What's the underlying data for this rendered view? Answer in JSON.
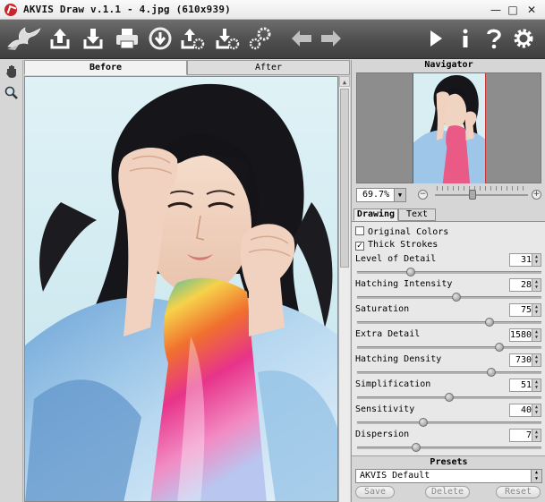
{
  "window": {
    "title": "AKVIS Draw v.1.1 - 4.jpg (610x939)",
    "minimize": "—",
    "maximize": "□",
    "close": "✕"
  },
  "toolbar": {
    "icons": [
      "akvis-bird-logo",
      "open-icon",
      "save-icon",
      "print-icon",
      "share-icon",
      "import-settings-icon",
      "export-settings-icon",
      "batch-icon",
      "undo-icon",
      "redo-icon",
      "run-icon",
      "info-icon",
      "help-icon",
      "preferences-icon"
    ]
  },
  "view_tabs": {
    "before": "Before",
    "after": "After",
    "active": "Before"
  },
  "navigator": {
    "title": "Navigator",
    "zoom": "69.7%"
  },
  "panel_tabs": {
    "drawing": "Drawing",
    "text": "Text",
    "active": "Drawing"
  },
  "options": {
    "original_colors": {
      "label": "Original Colors",
      "checked": false,
      "mark": ""
    },
    "thick_strokes": {
      "label": "Thick Strokes",
      "checked": true,
      "mark": "✓"
    }
  },
  "params": [
    {
      "label": "Level of Detail",
      "value": "31",
      "fraction": 0.29
    },
    {
      "label": "Hatching Intensity",
      "value": "28",
      "fraction": 0.54
    },
    {
      "label": "Saturation",
      "value": "75",
      "fraction": 0.72
    },
    {
      "label": "Extra Detail",
      "value": "1580",
      "fraction": 0.77
    },
    {
      "label": "Hatching Density",
      "value": "730",
      "fraction": 0.73
    },
    {
      "label": "Simplification",
      "value": "51",
      "fraction": 0.5
    },
    {
      "label": "Sensitivity",
      "value": "40",
      "fraction": 0.36
    },
    {
      "label": "Dispersion",
      "value": "7",
      "fraction": 0.32
    }
  ],
  "zoom_slider_fraction": 0.4,
  "presets": {
    "title": "Presets",
    "selected": "AKVIS Default",
    "save": "Save",
    "delete": "Delete",
    "reset": "Reset"
  }
}
